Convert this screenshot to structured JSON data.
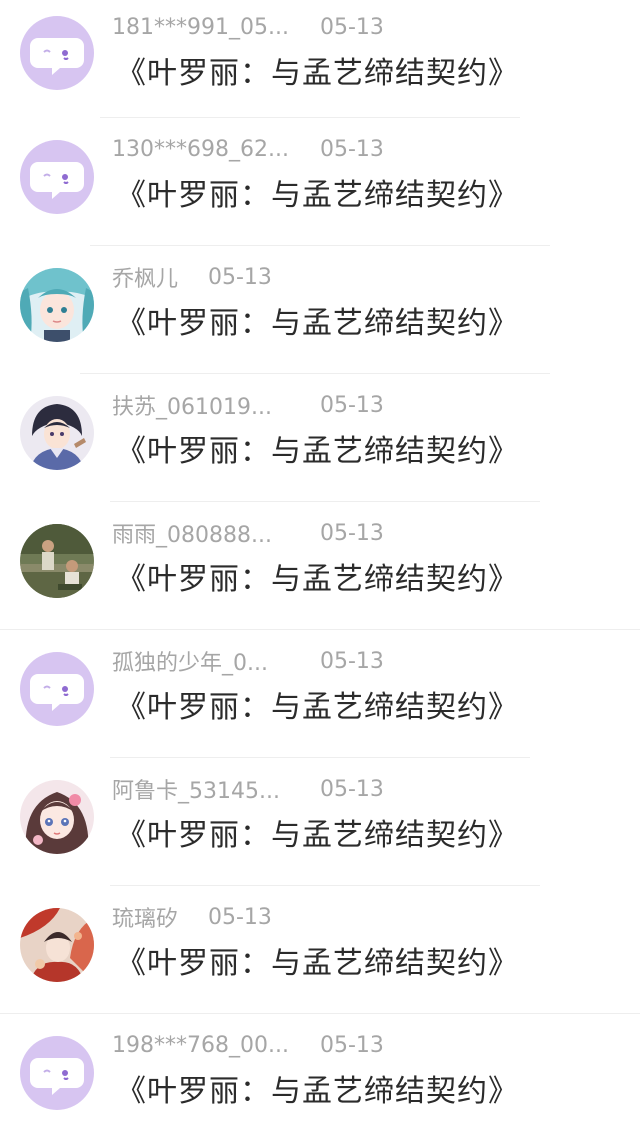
{
  "rows": [
    {
      "name": "181***991_05...",
      "date": "05-13",
      "title": "《叶罗丽：与孟艺缔结契约》",
      "avatar": "default-chat-avatar"
    },
    {
      "name": "130***698_62...",
      "date": "05-13",
      "title": "《叶罗丽：与孟艺缔结契约》",
      "avatar": "default-chat-avatar"
    },
    {
      "name": "乔枫儿",
      "date": "05-13",
      "title": "《叶罗丽：与孟艺缔结契约》",
      "avatar": "anime-teal-hair-avatar"
    },
    {
      "name": "扶苏_061019...",
      "date": "05-13",
      "title": "《叶罗丽：与孟艺缔结契约》",
      "avatar": "anime-dark-hair-avatar"
    },
    {
      "name": "雨雨_080888...",
      "date": "05-13",
      "title": "《叶罗丽：与孟艺缔结契约》",
      "avatar": "photo-outdoor-avatar"
    },
    {
      "name": "孤独的少年_0...",
      "date": "05-13",
      "title": "《叶罗丽：与孟艺缔结契约》",
      "avatar": "default-chat-avatar"
    },
    {
      "name": "阿鲁卡_53145...",
      "date": "05-13",
      "title": "《叶罗丽：与孟艺缔结契约》",
      "avatar": "anime-pink-girl-avatar"
    },
    {
      "name": "琉璃矽",
      "date": "05-13",
      "title": "《叶罗丽：与孟艺缔结契约》",
      "avatar": "anime-red-art-avatar"
    },
    {
      "name": "198***768_00...",
      "date": "05-13",
      "title": "《叶罗丽：与孟艺缔结契约》",
      "avatar": "default-chat-avatar"
    }
  ],
  "colors": {
    "default_avatar_bg": "#d7c5f1",
    "name_text": "#a6a6a6",
    "title_text": "#2b2b2b",
    "divider": "#eeeeee"
  }
}
